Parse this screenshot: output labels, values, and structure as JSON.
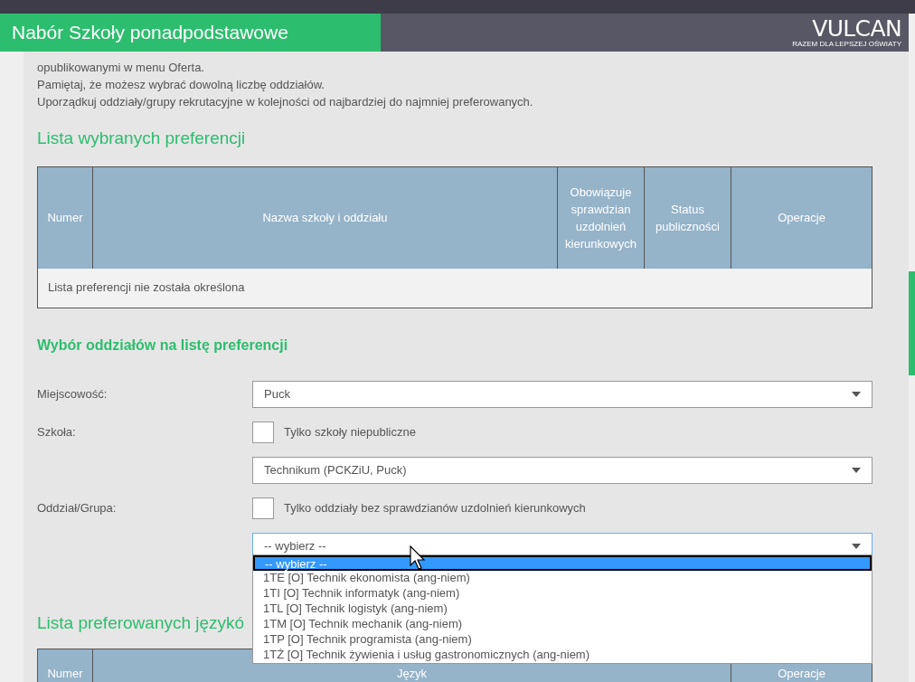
{
  "header": {
    "title": "Nabór Szkoły ponadpodstawowe",
    "logo": "VULCAN",
    "logo_tagline": "RAZEM DLA LEPSZEJ OŚWIATY"
  },
  "intro": [
    "opublikowanymi w menu Oferta.",
    "Pamiętaj, że możesz wybrać dowolną liczbę oddziałów.",
    "Uporządkuj oddziały/grupy rekrutacyjne w kolejności od najbardziej do najmniej preferowanych."
  ],
  "preferences": {
    "title": "Lista wybranych preferencji",
    "columns": [
      "Numer",
      "Nazwa szkoły i oddziału",
      "Obowiązuje sprawdzian uzdolnień kierunkowych",
      "Status publiczności",
      "Operacje"
    ],
    "empty_message": "Lista preferencji nie została określona"
  },
  "selection": {
    "title": "Wybór oddziałów na listę preferencji",
    "fields": [
      {
        "kind": "select",
        "label": "Miejscowość:",
        "value": "Puck",
        "focused": false
      },
      {
        "kind": "checkbox",
        "label": "Szkoła:",
        "text": "Tylko szkoły niepubliczne",
        "checked": false
      },
      {
        "kind": "select",
        "value": "Technikum (PCKZiU, Puck)",
        "focused": false
      },
      {
        "kind": "checkbox",
        "label": "Oddział/Grupa:",
        "text": "Tylko oddziały bez sprawdzianów uzdolnień kierunkowych",
        "checked": false
      },
      {
        "kind": "select",
        "value": "-- wybierz --",
        "focused": true
      }
    ],
    "dropdown_options": [
      {
        "label": "-- wybierz --",
        "selected": true
      },
      {
        "label": "1TE [O] Technik ekonomista (ang-niem)",
        "selected": false
      },
      {
        "label": "1TI [O] Technik informatyk (ang-niem)",
        "selected": false
      },
      {
        "label": "1TL [O] Technik logistyk (ang-niem)",
        "selected": false
      },
      {
        "label": "1TM [O] Technik mechanik (ang-niem)",
        "selected": false
      },
      {
        "label": "1TP [O] Technik programista (ang-niem)",
        "selected": false
      },
      {
        "label": "1TŻ [O] Technik żywienia i usług gastronomicznych (ang-niem)",
        "selected": false
      }
    ]
  },
  "languages": {
    "title": "Lista preferowanych językó",
    "columns": [
      "Numer",
      "Język",
      "Operacje"
    ]
  }
}
